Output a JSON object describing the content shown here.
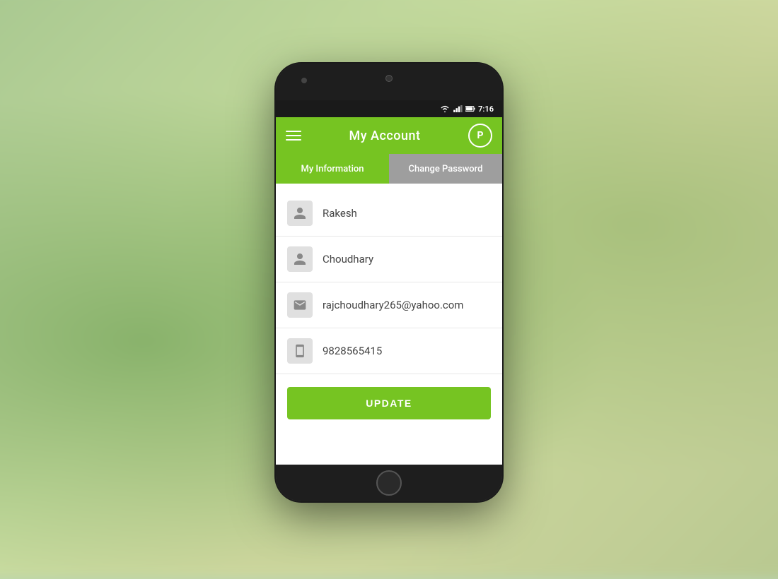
{
  "background": {
    "color": "#b8d4b0"
  },
  "status_bar": {
    "time": "7:16",
    "icons": [
      "wifi",
      "signal",
      "battery"
    ]
  },
  "app_bar": {
    "title": "My Account",
    "menu_icon_label": "menu",
    "logo_text": "P"
  },
  "tabs": [
    {
      "label": "My Information",
      "active": true
    },
    {
      "label": "Change Password",
      "active": false
    }
  ],
  "fields": [
    {
      "icon": "person",
      "value": "Rakesh"
    },
    {
      "icon": "person",
      "value": "Choudhary"
    },
    {
      "icon": "email",
      "value": "rajchoudhary265@yahoo.com"
    },
    {
      "icon": "phone",
      "value": "9828565415"
    }
  ],
  "update_button": {
    "label": "UPDATE"
  }
}
